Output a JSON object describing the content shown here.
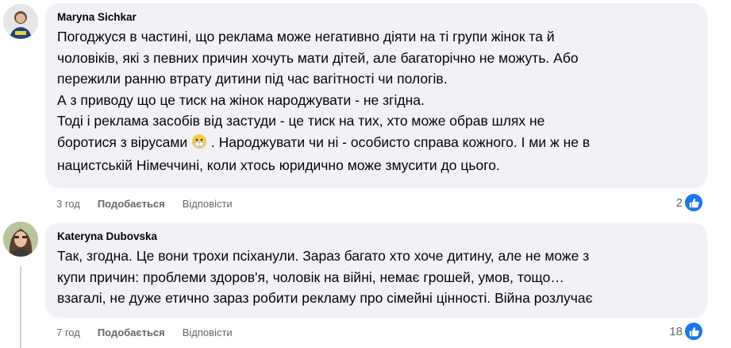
{
  "comments": [
    {
      "author": "Maryna Sichkar",
      "lines": [
        "Погоджуся в частині, що реклама може негативно діяти на ті групи жінок та й",
        "чоловіків, які з певних причин хочуть мати дітей, але багаторічно не можуть. Або",
        "пережили ранню втрату дитини під час вагітності чи пологів.",
        "А з приводу що це тиск на жінок народжувати - не згідна.",
        "Тоді і реклама засобів від застуди - це тиск на тих, хто може обрав шлях не",
        "боротися з вірусами",
        " . Народжувати чи ні - особисто справа кожного. І ми ж не в",
        "нацистській Німеччині, коли хтось юридично може змусити до цього."
      ],
      "emoji": "sick-face-emoji",
      "time": "3 год",
      "like_label": "Подобається",
      "reply_label": "Відповісти",
      "reaction_count": "2"
    },
    {
      "author": "Kateryna Dubovska",
      "lines": [
        "Так, згодна. Це вони трохи псіханули. Зараз багато хто хоче дитину, але не може з",
        "купи причин: проблеми здоров'я, чоловік на війні, немає грошей, умов, тощо…",
        "взагалі, не дуже етично зараз робити рекламу про сімейні цінності. Війна розлучає"
      ],
      "time": "7 год",
      "like_label": "Подобається",
      "reply_label": "Відповісти",
      "reaction_count": "18"
    }
  ],
  "colors": {
    "bubble": "#f0f2f5",
    "meta_text": "#65676b",
    "like_blue": "#1877f2"
  }
}
